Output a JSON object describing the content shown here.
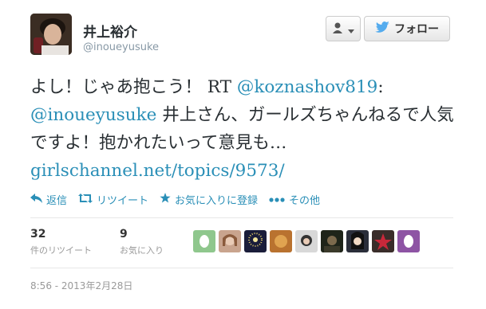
{
  "user": {
    "name": "井上裕介",
    "handle": "@inoueyusuke"
  },
  "buttons": {
    "follow_label": "フォロー"
  },
  "tweet": {
    "part1": "よし！じゃあ抱こう！ RT ",
    "mention1": "@koznashov819",
    "part2": ": ",
    "mention2": "@inoueyusuke",
    "part3": " 井上さん、ガールズちゃんねるで人気ですよ！抱かれたいって意見も…",
    "link": "girlschannel.net/topics/9573/"
  },
  "actions": {
    "reply": "返信",
    "retweet": "リツイート",
    "favorite": "お気に入りに登録",
    "more": "その他"
  },
  "stats": {
    "retweets": {
      "count": "32",
      "label": "件のリツイート"
    },
    "favorites": {
      "count": "9",
      "label": "お気に入り"
    }
  },
  "timestamp": "8:56 - 2013年2月28日",
  "colors": {
    "link": "#2a8fb7",
    "twitter_blue": "#55acee"
  }
}
